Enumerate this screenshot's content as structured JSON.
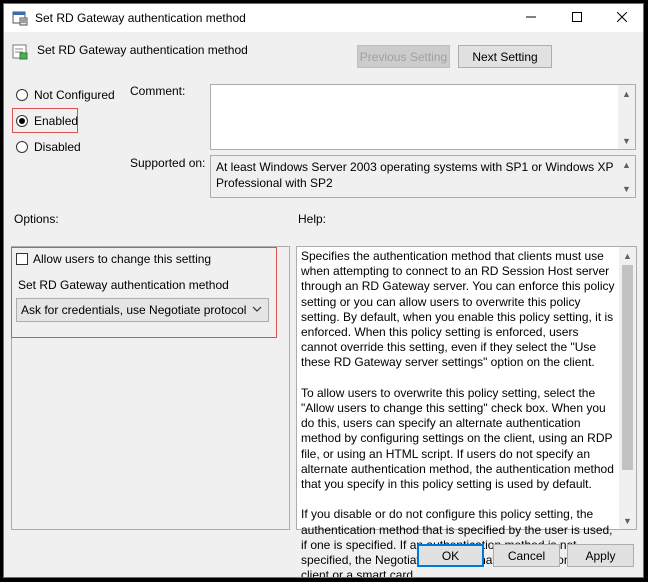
{
  "window": {
    "title": "Set RD Gateway authentication method"
  },
  "header": {
    "title": "Set RD Gateway authentication method"
  },
  "nav": {
    "previous_label": "Previous Setting",
    "next_label": "Next Setting"
  },
  "state": {
    "options": [
      {
        "label": "Not Configured",
        "selected": false
      },
      {
        "label": "Enabled",
        "selected": true
      },
      {
        "label": "Disabled",
        "selected": false
      }
    ]
  },
  "comment": {
    "label": "Comment:",
    "value": ""
  },
  "supported": {
    "label": "Supported on:",
    "text": "At least Windows Server 2003 operating systems with SP1 or Windows XP Professional with SP2"
  },
  "options_section": {
    "label": "Options:",
    "allow_change_label": "Allow users to change this setting",
    "allow_change_checked": false,
    "method_label": "Set RD Gateway authentication method",
    "method_value": "Ask for credentials, use Negotiate protocol"
  },
  "help": {
    "label": "Help:",
    "paragraphs": [
      "Specifies the authentication method that clients must use when attempting to connect to an RD Session Host server through an RD Gateway server. You can enforce this policy setting or you can allow users to overwrite this policy setting. By default, when you enable this policy setting, it is enforced. When this policy setting is enforced, users cannot override this setting, even if they select the \"Use these RD Gateway server settings\" option on the client.",
      "To allow users to overwrite this policy setting, select the \"Allow users to change this setting\" check box. When you do this, users can specify an alternate authentication method by configuring settings on the client, using an RDP file, or using an HTML script. If users do not specify an alternate authentication method, the authentication method that you specify in this policy setting is used by default.",
      "If you disable or do not configure this policy setting, the authentication method that is specified by the user is used, if one is specified. If an authentication method is not specified, the Negotiate protocol that is enabled on the client or a smart card"
    ]
  },
  "footer": {
    "ok_label": "OK",
    "cancel_label": "Cancel",
    "apply_label": "Apply"
  }
}
